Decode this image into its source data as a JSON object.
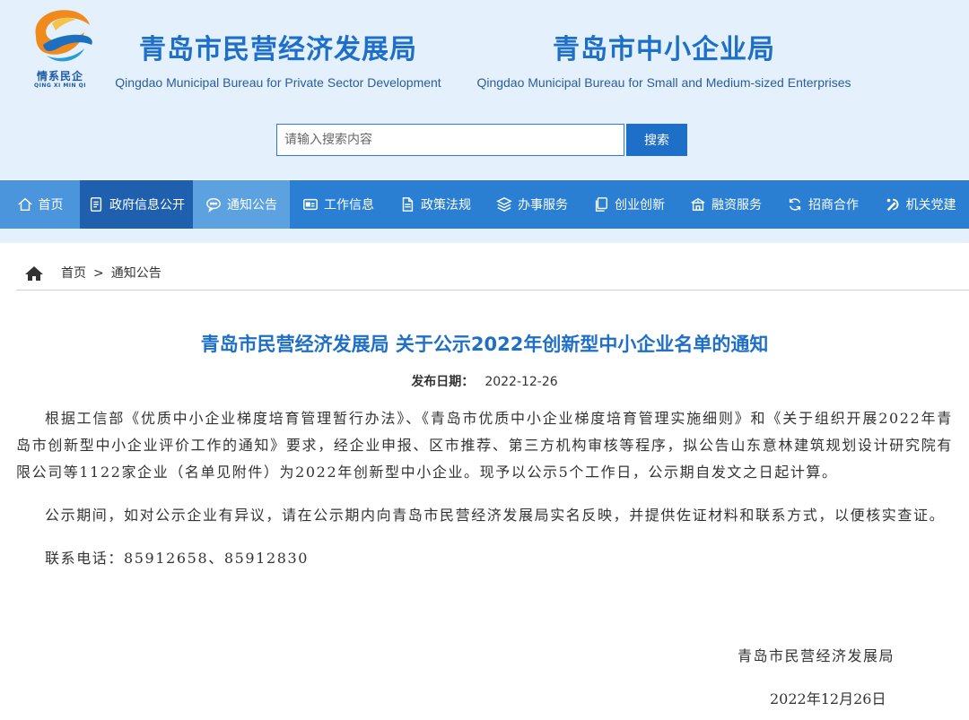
{
  "header": {
    "logo_cn": "情系民企",
    "logo_en": "QING XI MIN QI",
    "site1_cn": "青岛市民营经济发展局",
    "site1_en": "Qingdao Municipal Bureau for Private Sector Development",
    "site2_cn": "青岛市中小企业局",
    "site2_en": "Qingdao Municipal Bureau for Small and Medium-sized Enterprises",
    "search_placeholder": "请输入搜索内容",
    "search_button": "搜索"
  },
  "nav": {
    "items": [
      {
        "label": "首页",
        "icon": "home-icon"
      },
      {
        "label": "政府信息公开",
        "icon": "document-icon"
      },
      {
        "label": "通知公告",
        "icon": "chat-icon"
      },
      {
        "label": "工作信息",
        "icon": "card-icon"
      },
      {
        "label": "政策法规",
        "icon": "file-icon"
      },
      {
        "label": "办事服务",
        "icon": "layers-icon"
      },
      {
        "label": "创业创新",
        "icon": "copy-icon"
      },
      {
        "label": "融资服务",
        "icon": "building-icon"
      },
      {
        "label": "招商合作",
        "icon": "refresh-icon"
      },
      {
        "label": "机关党建",
        "icon": "party-emblem-icon"
      }
    ]
  },
  "breadcrumb": {
    "home": "首页",
    "separator": ">",
    "current": "通知公告"
  },
  "article": {
    "title": "青岛市民营经济发展局 关于公示2022年创新型中小企业名单的通知",
    "date_label": "发布日期：",
    "date_value": "2022-12-26",
    "paragraphs": [
      "根据工信部《优质中小企业梯度培育管理暂行办法》、《青岛市优质中小企业梯度培育管理实施细则》和《关于组织开展2022年青岛市创新型中小企业评价工作的通知》要求，经企业申报、区市推荐、第三方机构审核等程序，拟公告山东意林建筑规划设计研究院有限公司等1122家企业（名单见附件）为2022年创新型中小企业。现予以公示5个工作日，公示期自发文之日起计算。",
      "公示期间，如对公示企业有异议，请在公示期内向青岛市民营经济发展局实名反映，并提供佐证材料和联系方式，以便核实查证。",
      "联系电话：85912658、85912830"
    ],
    "signature": "青岛市民营经济发展局",
    "sign_date": "2022年12月26日"
  },
  "colors": {
    "brand_blue": "#1e6fc8",
    "nav_blue": "#2a7fd2",
    "header_bg": "#e4f0fb"
  }
}
